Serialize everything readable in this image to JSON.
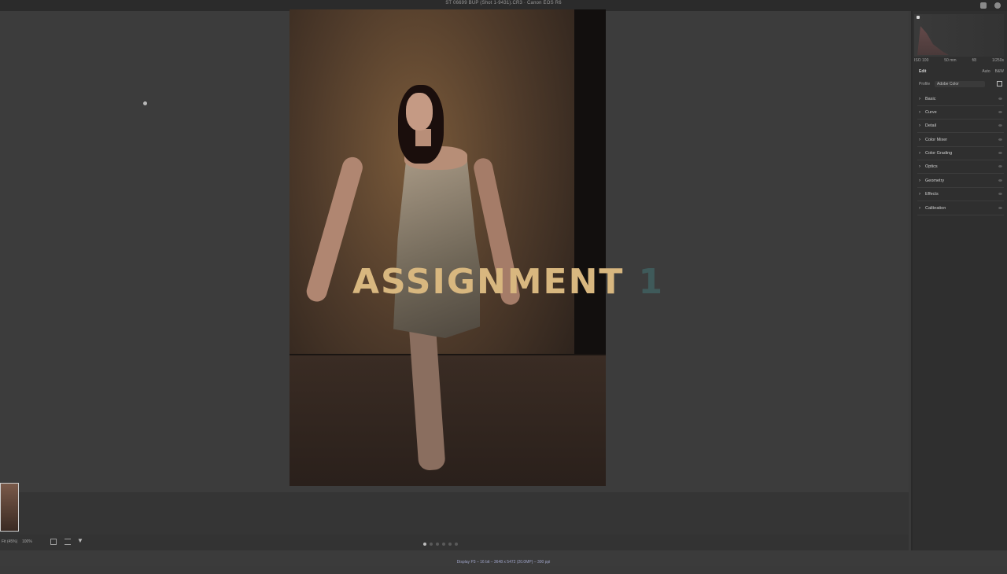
{
  "window": {
    "title": "ST 06699 BUP (Shot 1-9431).CR3  ·  Canon EOS R6",
    "icons": [
      "save-icon",
      "settings-icon"
    ]
  },
  "overlay": {
    "word": "ASSIGNMENT",
    "number": "1",
    "word_color": "#d8b77f",
    "number_color": "#3f5a5a"
  },
  "panel": {
    "exif": [
      "ISO 100",
      "50 mm",
      "f/8",
      "1/250s"
    ],
    "edit_title": "Edit",
    "edit_actions": [
      "Auto",
      "B&W"
    ],
    "profile_label": "Profile",
    "profile_value": "Adobe Color",
    "sections": [
      "Basic",
      "Curve",
      "Detail",
      "Color Mixer",
      "Color Grading",
      "Optics",
      "Geometry",
      "Effects",
      "Calibration"
    ]
  },
  "bottombar": {
    "fit": "Fit (45%)",
    "zoom": "100%"
  },
  "pagination": {
    "count": 6,
    "active_index": 0
  },
  "statusbar": {
    "text": "Display P3 – 16 bit – 3648 x 5472 (20.0MP) – 300 ppi"
  }
}
